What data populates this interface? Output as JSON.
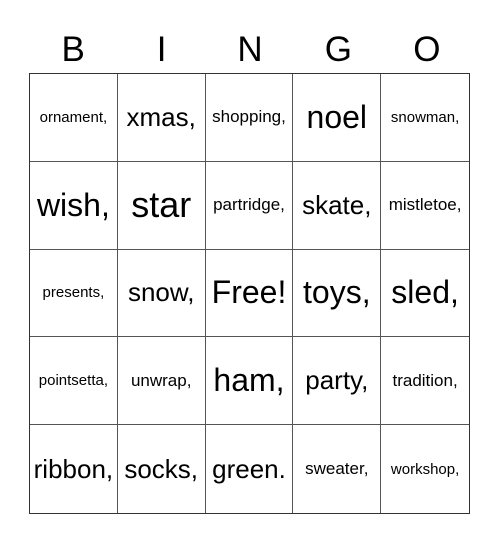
{
  "header": [
    "B",
    "I",
    "N",
    "G",
    "O"
  ],
  "cells": [
    {
      "text": "ornament,",
      "size": "s1"
    },
    {
      "text": "xmas,",
      "size": "s3"
    },
    {
      "text": "shopping,",
      "size": "s2"
    },
    {
      "text": "noel",
      "size": "s4"
    },
    {
      "text": "snowman,",
      "size": "s1"
    },
    {
      "text": "wish,",
      "size": "s4"
    },
    {
      "text": "star",
      "size": "s5"
    },
    {
      "text": "partridge,",
      "size": "s2"
    },
    {
      "text": "skate,",
      "size": "s3"
    },
    {
      "text": "mistletoe,",
      "size": "s2"
    },
    {
      "text": "presents,",
      "size": "s1"
    },
    {
      "text": "snow,",
      "size": "s3"
    },
    {
      "text": "Free!",
      "size": "s4"
    },
    {
      "text": "toys,",
      "size": "s4"
    },
    {
      "text": "sled,",
      "size": "s4"
    },
    {
      "text": "pointsetta,",
      "size": "s1"
    },
    {
      "text": "unwrap,",
      "size": "s2"
    },
    {
      "text": "ham,",
      "size": "s4"
    },
    {
      "text": "party,",
      "size": "s3"
    },
    {
      "text": "tradition,",
      "size": "s2"
    },
    {
      "text": "ribbon,",
      "size": "s3"
    },
    {
      "text": "socks,",
      "size": "s3"
    },
    {
      "text": "green.",
      "size": "s3"
    },
    {
      "text": "sweater,",
      "size": "s2"
    },
    {
      "text": "workshop,",
      "size": "s1"
    }
  ]
}
